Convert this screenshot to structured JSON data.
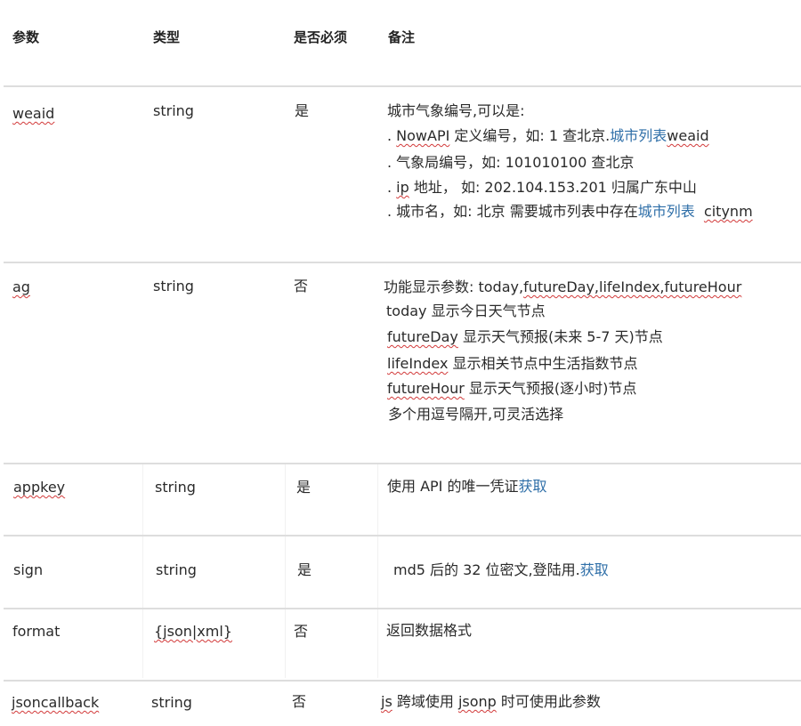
{
  "headers": {
    "param": "参数",
    "type": "类型",
    "required": "是否必须",
    "note": "备注"
  },
  "rows": [
    {
      "param": "weaid",
      "type": "string",
      "required": "是",
      "notes": [
        {
          "text": "城市气象编号,可以是:"
        },
        {
          "prefix": ". ",
          "squiggle": "NowAPI",
          "text": " 定义编号，如: 1 查北京.",
          "link": "城市列表",
          "link2": "weaid"
        },
        {
          "text": ". 气象局编号，如: 101010100 查北京"
        },
        {
          "prefix": ". ",
          "squiggle": "ip",
          "text": " 地址，  如: 202.104.153.201 归属广东中山"
        },
        {
          "text": ". 城市名，如: 北京  需要城市列表中存在",
          "link": "城市列表",
          "tail": "cit​ynm"
        }
      ]
    },
    {
      "param": "ag",
      "type": "string",
      "required": "否",
      "notes": [
        {
          "text": "功能显示参数: today,",
          "squiggle": "futureDay,lifeIndex,futureHour"
        },
        {
          "text": "today 显示今日天气节点"
        },
        {
          "squiggle": "futureDay",
          "text": " 显示天气预报(未来 5-7 天)节点"
        },
        {
          "squiggle": "lifeIndex",
          "text": " 显示相关节点中生活指数节点"
        },
        {
          "squiggle": "futureHour",
          "text": " 显示天气预报(逐小时)节点"
        },
        {
          "text": "多个用逗号隔开,可灵活选择"
        }
      ]
    },
    {
      "param": "appkey",
      "type": "string",
      "required": "是",
      "notes": [
        {
          "text": "使用  API 的唯一凭证",
          "link": "获取"
        }
      ]
    },
    {
      "param": "sign",
      "type": "string",
      "required": "是",
      "notes": [
        {
          "text": "md5 后的  32 位密文,登陆用.",
          "link": "获取"
        }
      ]
    },
    {
      "param": "format",
      "type": "{json|xml}",
      "required": "否",
      "notes": [
        {
          "text": "返回数据格式"
        }
      ]
    },
    {
      "param": "jsoncallback",
      "type": "string",
      "required": "否",
      "notes": [
        {
          "squiggle": "js",
          "text": " 跨域使用  ",
          "squiggle2": "jsonp",
          "text2": " 时可使用此参数"
        }
      ]
    }
  ]
}
